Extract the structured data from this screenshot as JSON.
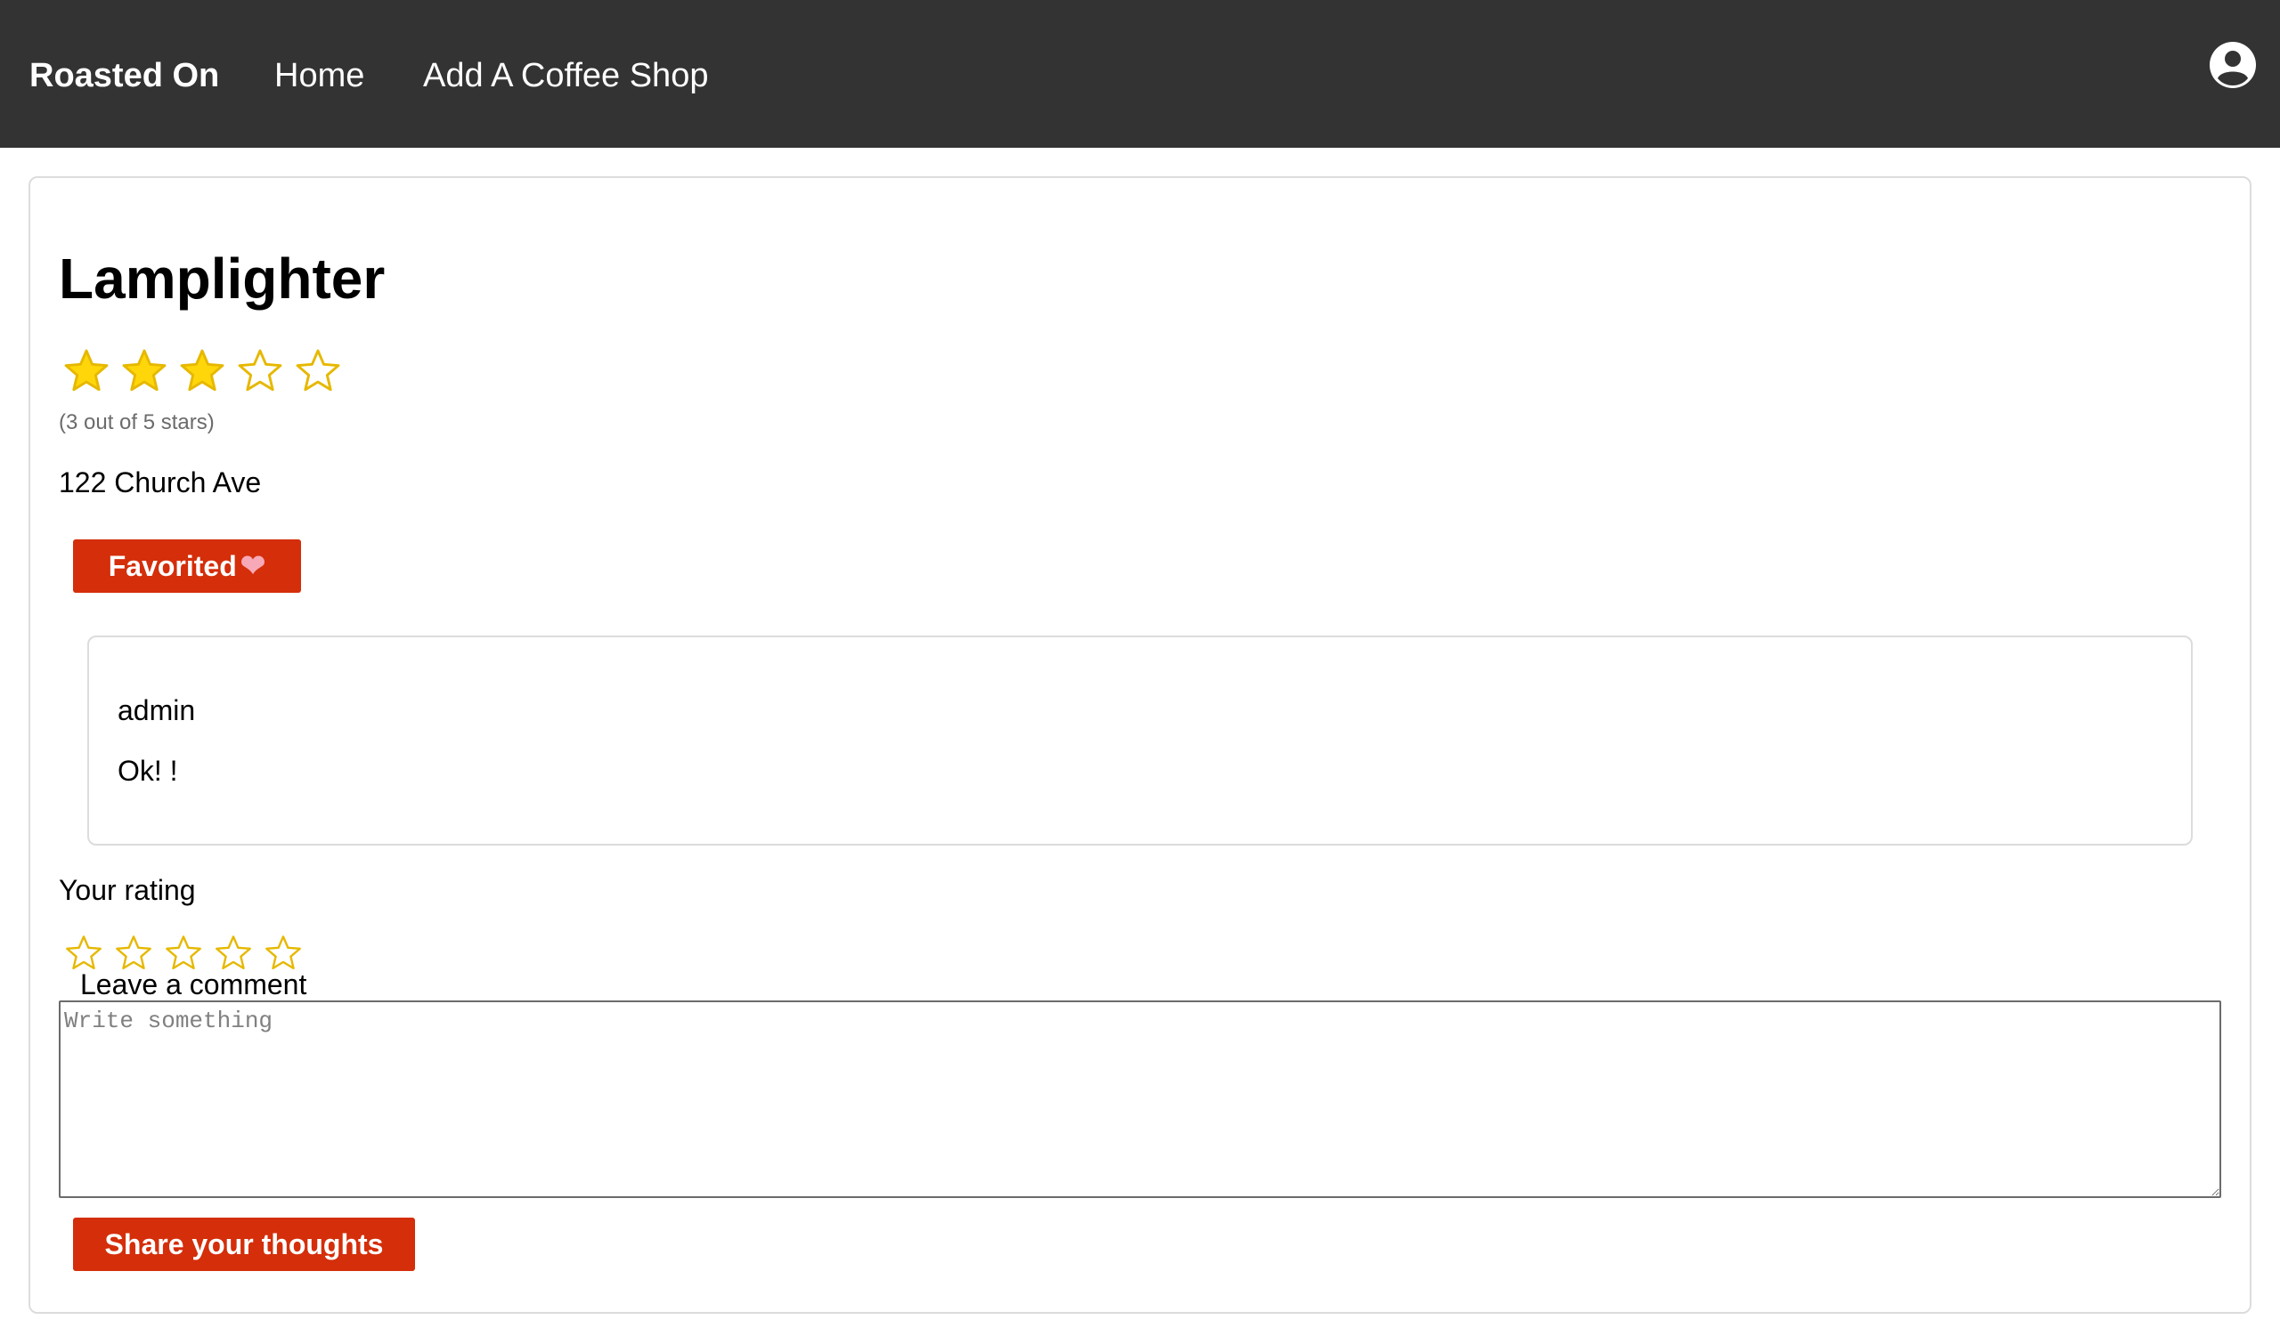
{
  "nav": {
    "brand": "Roasted On",
    "links": [
      "Home",
      "Add A Coffee Shop"
    ],
    "user_icon": "user-circle-icon"
  },
  "shop": {
    "name": "Lamplighter",
    "rating": 3,
    "rating_max": 5,
    "rating_caption": "(3 out of 5 stars)",
    "address": "122 Church Ave",
    "favorite_label": "Favorited",
    "favorite_icon": "heart-icon"
  },
  "comments": [
    {
      "author": "admin",
      "body": "Ok! !"
    }
  ],
  "form": {
    "your_rating_label": "Your rating",
    "your_rating_value": 0,
    "comment_label": "Leave a comment",
    "comment_placeholder": "Write something",
    "comment_value": "",
    "submit_label": "Share your thoughts"
  },
  "colors": {
    "navbar_bg": "#333333",
    "button_bg": "#d42e0a",
    "star_fill": "#ffd60a",
    "star_outline": "#e6b800",
    "heart": "#f7a9b8"
  }
}
